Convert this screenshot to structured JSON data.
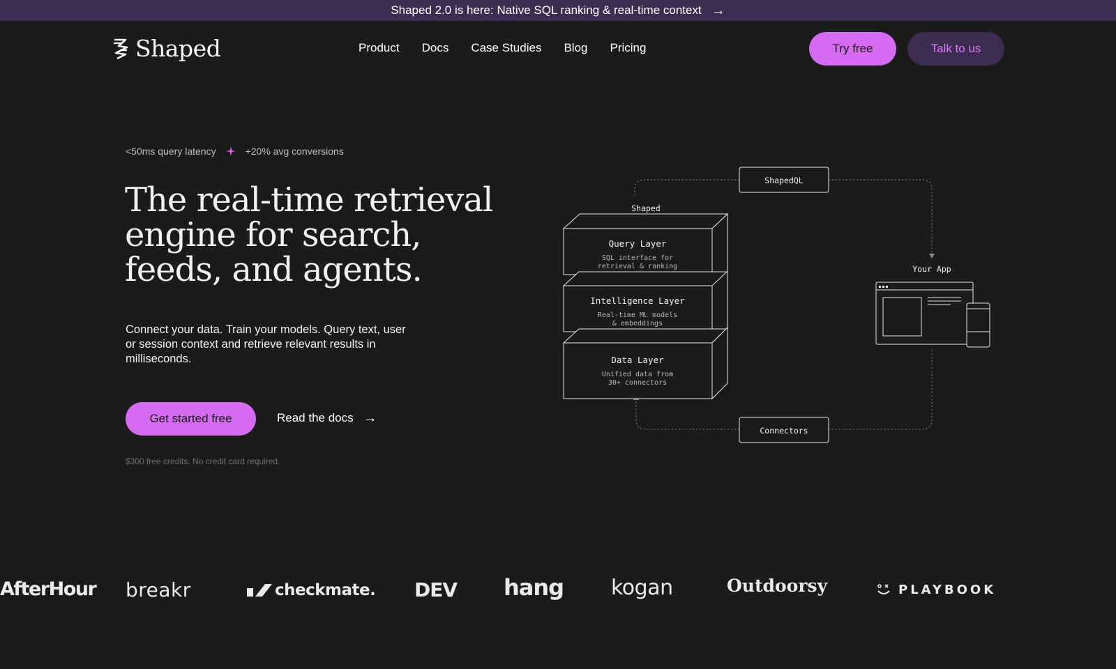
{
  "banner": {
    "text": "Shaped 2.0 is here: Native SQL ranking & real-time context",
    "arrow": "→"
  },
  "header": {
    "logo_text": "Shaped",
    "nav": [
      "Product",
      "Docs",
      "Case Studies",
      "Blog",
      "Pricing"
    ],
    "try_free": "Try free",
    "talk_to_us": "Talk to us"
  },
  "hero": {
    "stat_latency": "<50ms query latency",
    "stat_conversions": "+20% avg conversions",
    "title": "The real-time retrieval engine for search, feeds, and agents.",
    "subtitle": "Connect your data. Train your models. Query text, user or session context and retrieve relevant results in milliseconds.",
    "cta_primary": "Get started free",
    "cta_secondary": "Read the docs",
    "arrow": "→",
    "credits_note": "$300 free credits. No credit card required."
  },
  "diagram": {
    "shapedql": "ShapedQL",
    "shaped_label": "Shaped",
    "your_app": "Your App",
    "connectors": "Connectors",
    "layers": [
      {
        "title": "Query Layer",
        "desc1": "SQL interface for",
        "desc2": "retrieval & ranking"
      },
      {
        "title": "Intelligence Layer",
        "desc1": "Real-time ML models",
        "desc2": "& embeddings"
      },
      {
        "title": "Data Layer",
        "desc1": "Unified data from",
        "desc2": "30+ connectors"
      }
    ]
  },
  "customers": [
    "AfterHour",
    "breakr",
    "checkmate.",
    "DEV",
    "hang",
    "kogan",
    "Outdoorsy",
    "PLAYBOOK"
  ],
  "colors": {
    "accent": "#d46bf0",
    "banner_bg": "#3e2d52",
    "background": "#1b1b1b"
  }
}
